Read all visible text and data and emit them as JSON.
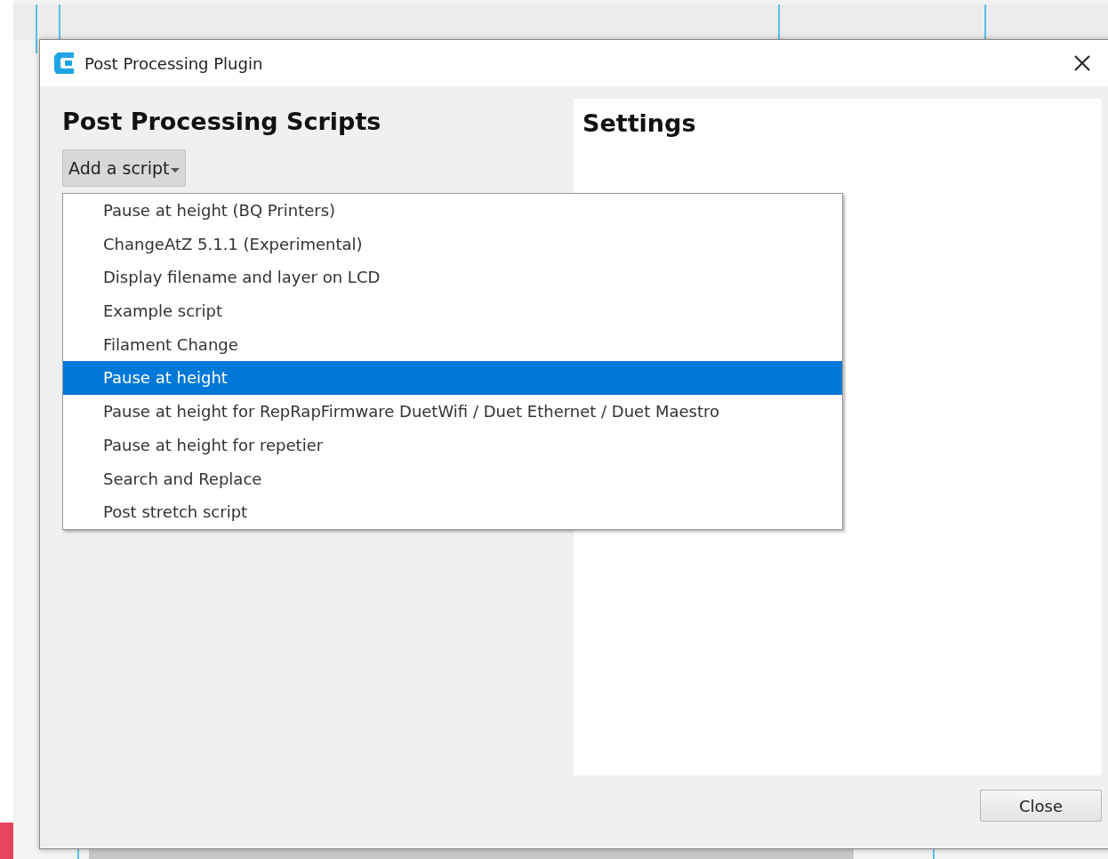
{
  "window": {
    "title": "Post Processing Plugin"
  },
  "scripts_panel": {
    "heading": "Post Processing Scripts",
    "add_button": "Add a script"
  },
  "script_menu": [
    {
      "label": "Pause at height (BQ Printers)",
      "selected": false
    },
    {
      "label": "ChangeAtZ 5.1.1 (Experimental)",
      "selected": false
    },
    {
      "label": "Display filename and layer on LCD",
      "selected": false
    },
    {
      "label": "Example script",
      "selected": false
    },
    {
      "label": "Filament Change",
      "selected": false
    },
    {
      "label": "Pause at height",
      "selected": true
    },
    {
      "label": "Pause at height for RepRapFirmware DuetWifi / Duet Ethernet / Duet Maestro",
      "selected": false
    },
    {
      "label": "Pause at height for repetier",
      "selected": false
    },
    {
      "label": "Search and Replace",
      "selected": false
    },
    {
      "label": "Post stretch script",
      "selected": false
    }
  ],
  "settings_panel": {
    "heading": "Settings"
  },
  "buttons": [
    "Close"
  ]
}
